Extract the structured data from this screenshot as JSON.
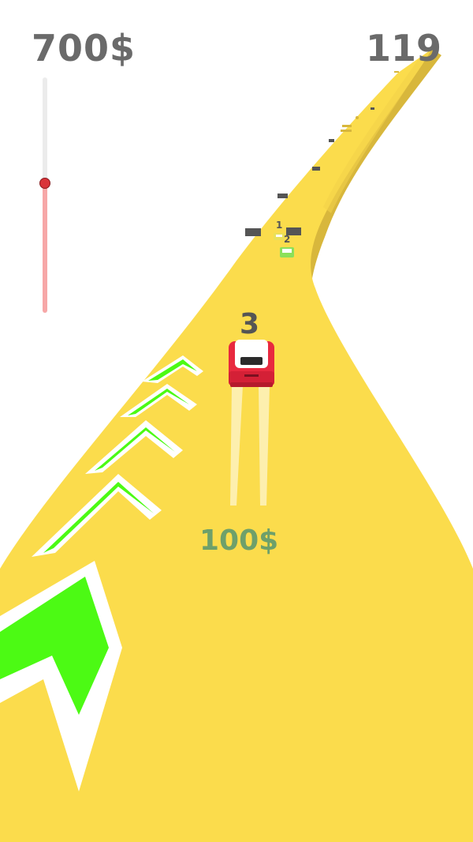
{
  "hud": {
    "money": "700$",
    "score": "119"
  },
  "progress": {
    "fraction": 0.55
  },
  "race": {
    "player_position": "3",
    "rivals": [
      {
        "position": "1",
        "color": "#e9e05a"
      },
      {
        "position": "2",
        "color": "#8be05a"
      }
    ]
  },
  "reward": {
    "text": "100$"
  },
  "colors": {
    "road": "#fbdc4c",
    "road_side": "#d8b73c",
    "boost_arrow": "#4cfa14",
    "player_car": "#e8293f",
    "hud_text": "#6a6a6a"
  },
  "icons": [
    "boost-arrow-icon",
    "player-car-icon",
    "obstacle-block-icon"
  ]
}
